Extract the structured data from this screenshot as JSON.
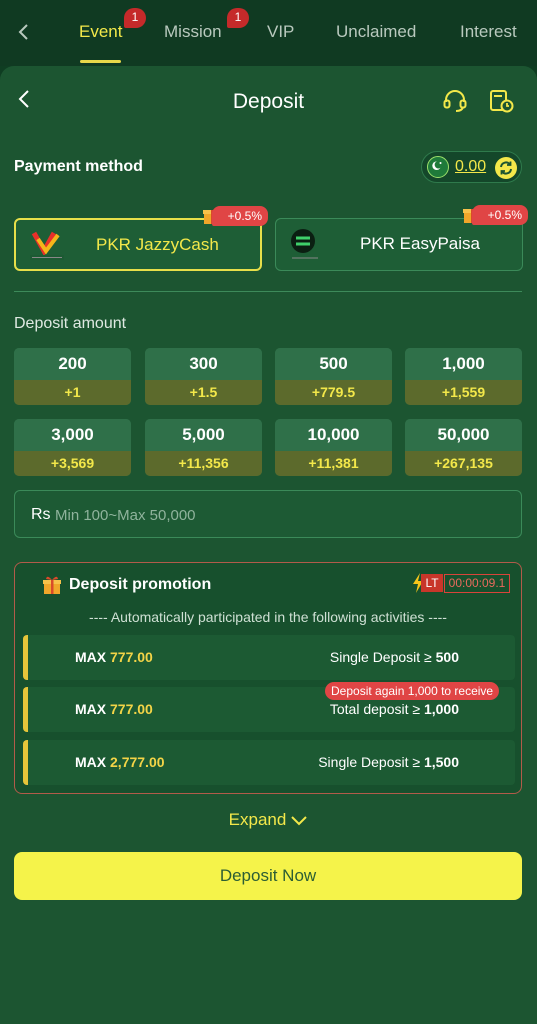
{
  "tabs": [
    {
      "label": "Event",
      "badge": "1"
    },
    {
      "label": "Mission",
      "badge": "1"
    },
    {
      "label": "VIP"
    },
    {
      "label": "Unclaimed"
    },
    {
      "label": "Interest"
    }
  ],
  "header": {
    "title": "Deposit"
  },
  "payment": {
    "label": "Payment method",
    "balance": "0.00",
    "methods": [
      {
        "name": "PKR JazzyCash",
        "bonus": "+0.5%",
        "selected": true
      },
      {
        "name": "PKR EasyPaisa",
        "bonus": "+0.5%",
        "selected": false
      }
    ]
  },
  "deposit": {
    "label": "Deposit amount",
    "amounts": [
      {
        "value": "200",
        "bonus": "+1"
      },
      {
        "value": "300",
        "bonus": "+1.5"
      },
      {
        "value": "500",
        "bonus": "+779.5"
      },
      {
        "value": "1,000",
        "bonus": "+1,559"
      },
      {
        "value": "3,000",
        "bonus": "+3,569"
      },
      {
        "value": "5,000",
        "bonus": "+11,356"
      },
      {
        "value": "10,000",
        "bonus": "+11,381"
      },
      {
        "value": "50,000",
        "bonus": "+267,135"
      }
    ],
    "currency": "Rs",
    "placeholder": "Min 100~Max 50,000"
  },
  "promotion": {
    "title": "Deposit promotion",
    "lt_label": "LT",
    "timer": "00:00:09.1",
    "subtitle": "---- Automatically participated in the following activities ----",
    "rows": [
      {
        "max_label": "MAX",
        "max_value": "777.00",
        "condition": "Single Deposit ≥",
        "threshold": "500"
      },
      {
        "max_label": "MAX",
        "max_value": "777.00",
        "condition": "Total deposit ≥",
        "threshold": "1,000"
      },
      {
        "max_label": "MAX",
        "max_value": "2,777.00",
        "condition": "Single Deposit ≥",
        "threshold": "1,500"
      }
    ],
    "tip": "Deposit again 1,000 to receive"
  },
  "expand_label": "Expand",
  "deposit_button": "Deposit Now",
  "colors": {
    "accent": "#f3e84a",
    "background": "#1c5531",
    "button": "#f5f34a",
    "alert": "#e04545"
  }
}
